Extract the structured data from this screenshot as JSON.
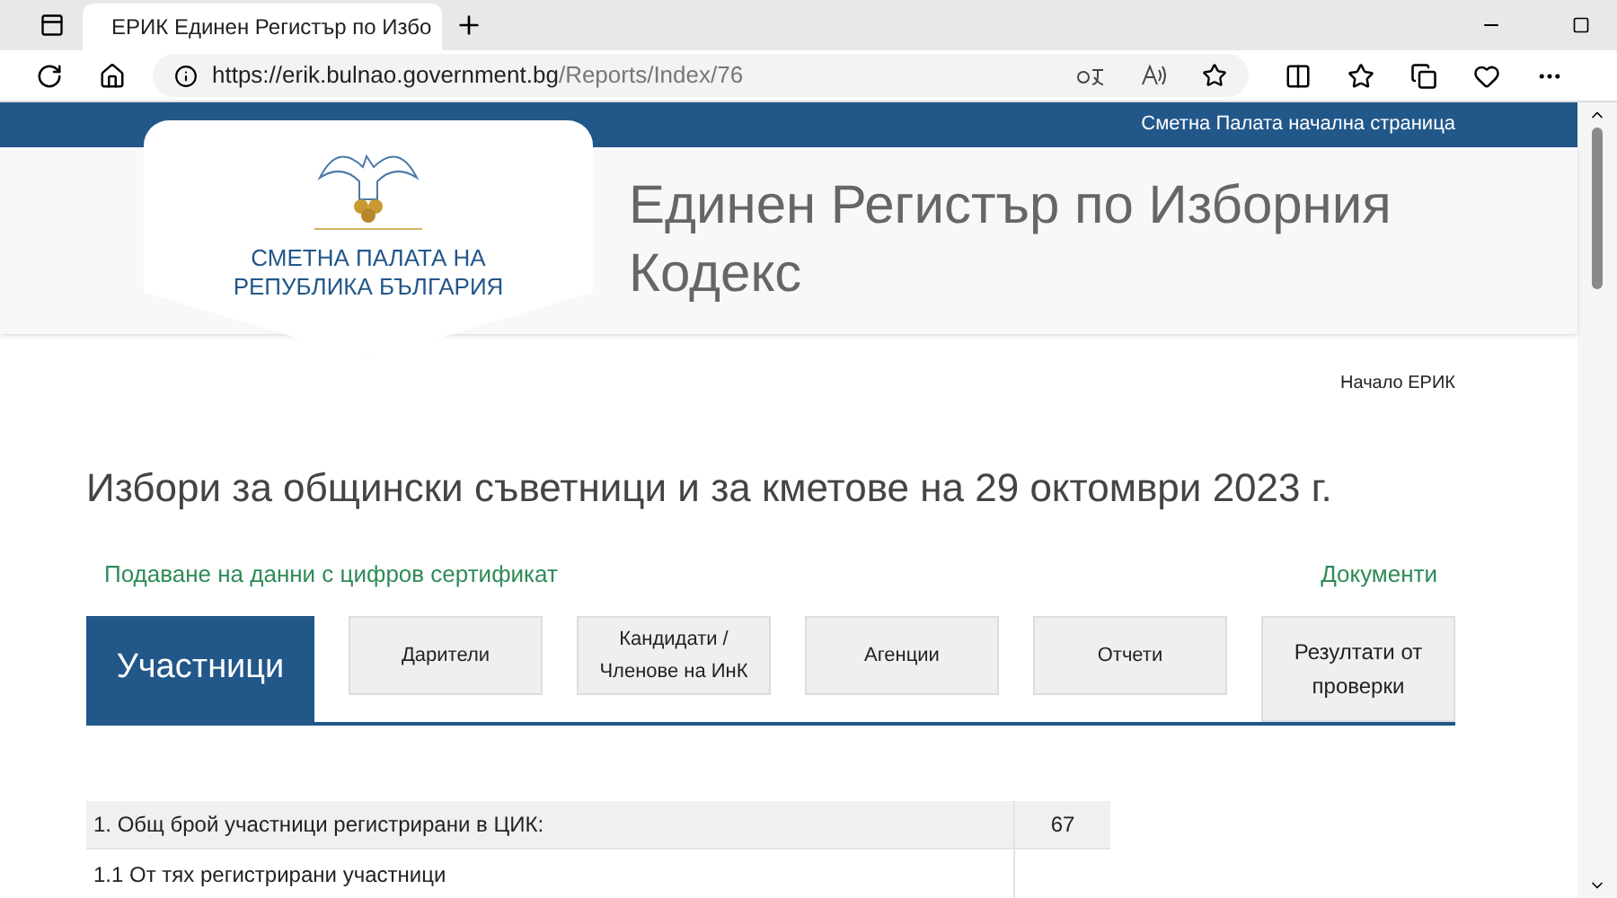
{
  "browser": {
    "tab_title": "ЕРИК Единен Регистър по Избо",
    "url_host": "https://erik.bulnao.government.bg",
    "url_path": "/Reports/Index/76"
  },
  "topbar": {
    "link": "Сметна Палата начална страница"
  },
  "logo": {
    "lines": [
      "СМЕТНА ПАЛАТА НА",
      "РЕПУБЛИКА БЪЛГАРИЯ"
    ]
  },
  "site_title": "Единен Регистър по Изборния Кодекс",
  "breadcrumb": "Начало ЕРИК",
  "heading": "Избори за общински съветници и за кметове на 29 октомври 2023 г.",
  "links": [
    "Подаване на данни с цифров сертификат",
    "Документи"
  ],
  "tabs": [
    {
      "label": "Участници",
      "selected": true
    },
    {
      "label": "Дарители",
      "selected": false
    },
    {
      "label": "Кандидати / Членове на ИнК",
      "selected": false
    },
    {
      "label": "Агенции",
      "selected": false
    },
    {
      "label": "Отчети",
      "selected": false
    },
    {
      "label": "Резултати от проверки",
      "selected": false
    }
  ],
  "table": {
    "rows": [
      {
        "label": "1. Общ брой участници регистрирани в ЦИК:",
        "value": "67"
      },
      {
        "label": "1.1 От тях регистрирани участници"
      }
    ]
  }
}
